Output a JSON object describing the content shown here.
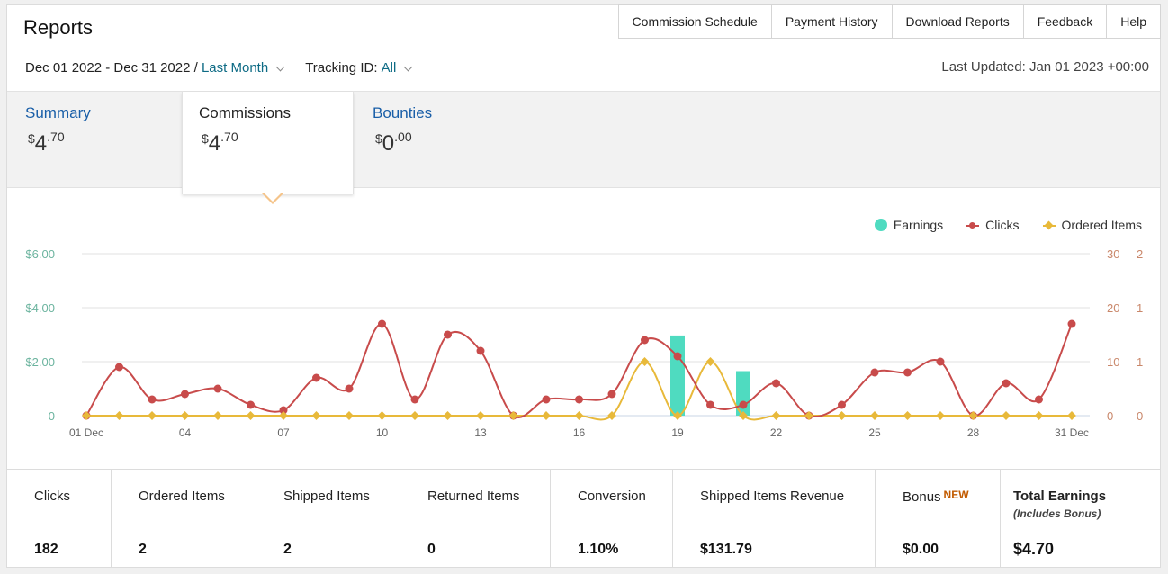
{
  "header": {
    "title": "Reports",
    "nav": [
      "Commission Schedule",
      "Payment History",
      "Download Reports",
      "Feedback",
      "Help"
    ]
  },
  "filters": {
    "date_range": "Dec 01 2022 - Dec 31 2022 /",
    "period": "Last Month",
    "tracking_label": "Tracking ID:",
    "tracking_value": "All"
  },
  "last_updated": "Last Updated: Jan 01 2023 +00:00",
  "tabs": [
    {
      "label": "Summary",
      "currency": "$",
      "whole": "4",
      "cents": ".70"
    },
    {
      "label": "Commissions",
      "currency": "$",
      "whole": "4",
      "cents": ".70"
    },
    {
      "label": "Bounties",
      "currency": "$",
      "whole": "0",
      "cents": ".00"
    }
  ],
  "legend": {
    "earnings": "Earnings",
    "clicks": "Clicks",
    "items": "Ordered Items"
  },
  "colors": {
    "earnings": "#4fdbc0",
    "clicks": "#c84b4b",
    "items": "#e8b93a",
    "grid": "#e0e0e0",
    "left_axis": "#6cb49f",
    "right_axis": "#c9876a"
  },
  "chart_data": {
    "type": "line",
    "x": [
      "01 Dec",
      "02",
      "03",
      "04",
      "05",
      "06",
      "07",
      "08",
      "09",
      "10",
      "11",
      "12",
      "13",
      "14",
      "15",
      "16",
      "17",
      "18",
      "19",
      "20",
      "21",
      "22",
      "23",
      "24",
      "25",
      "26",
      "27",
      "28",
      "29",
      "30",
      "31 Dec"
    ],
    "x_tick_labels": [
      "01 Dec",
      "04",
      "07",
      "10",
      "13",
      "16",
      "19",
      "22",
      "25",
      "28",
      "31 Dec"
    ],
    "left_axis_ticks": [
      "$6.00",
      "$4.00",
      "$2.00",
      "0"
    ],
    "right_axis_ticks": [
      "30",
      "20",
      "10",
      "0"
    ],
    "right_axis2_ticks": [
      "2",
      "1",
      "1",
      "0"
    ],
    "y_left_lim": [
      0,
      6
    ],
    "y_right_lim": [
      0,
      30
    ],
    "y_right2_lim": [
      0,
      2
    ],
    "series": [
      {
        "name": "Earnings",
        "kind": "bar",
        "axis": "left",
        "values": [
          0,
          0,
          0,
          0,
          0,
          0,
          0,
          0,
          0,
          0,
          0,
          0,
          0,
          0,
          0,
          0,
          0,
          0,
          2.97,
          0,
          1.65,
          0,
          0,
          0,
          0,
          0,
          0,
          0,
          0,
          0,
          0
        ]
      },
      {
        "name": "Clicks",
        "kind": "line",
        "axis": "right",
        "values": [
          0,
          9,
          3,
          4,
          5,
          2,
          1,
          7,
          5,
          17,
          3,
          15,
          12,
          0,
          3,
          3,
          4,
          14,
          11,
          2,
          2,
          6,
          0,
          2,
          8,
          8,
          10,
          0,
          6,
          3,
          17
        ]
      },
      {
        "name": "Ordered Items",
        "kind": "line",
        "axis": "right2",
        "values": [
          0,
          0,
          0,
          0,
          0,
          0,
          0,
          0,
          0,
          0,
          0,
          0,
          0,
          0,
          0,
          0,
          0,
          1,
          0,
          1,
          0,
          0,
          0,
          0,
          0,
          0,
          0,
          0,
          0,
          0,
          0
        ]
      }
    ]
  },
  "stats": [
    {
      "label": "Clicks",
      "value": "182"
    },
    {
      "label": "Ordered Items",
      "value": "2"
    },
    {
      "label": "Shipped Items",
      "value": "2"
    },
    {
      "label": "Returned Items",
      "value": "0"
    },
    {
      "label": "Conversion",
      "value": "1.10%"
    },
    {
      "label": "Shipped Items Revenue",
      "value": "$131.79"
    },
    {
      "label": "Bonus",
      "badge": "NEW",
      "value": "$0.00"
    },
    {
      "label": "Total Earnings",
      "sub": "(Includes Bonus)",
      "value": "$4.70"
    }
  ]
}
